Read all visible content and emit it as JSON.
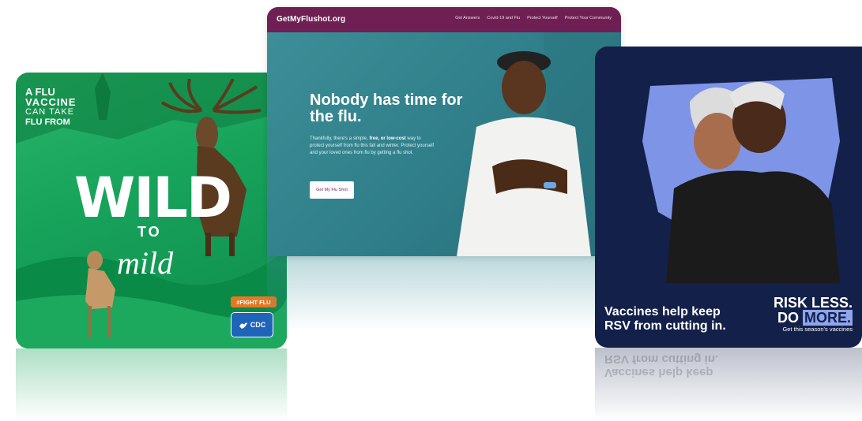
{
  "flu_card": {
    "line1": "A FLU",
    "line2": "VACCINE",
    "line3": "CAN TAKE",
    "line4": "FLU FROM",
    "headline": "WILD",
    "connector": "TO",
    "result": "mild",
    "tag": "#FIGHT FLU",
    "agency": "CDC"
  },
  "website": {
    "logo": "GetMyFlushot.org",
    "nav": [
      "Get Answers",
      "Covid-19 and Flu",
      "Protect Yourself",
      "Protect Your Community"
    ],
    "title": "Nobody has time for the flu.",
    "body_prefix": "Thankfully, there's a simple, ",
    "body_bold": "free, or low-cost",
    "body_suffix": " way to protect yourself from flu this fall and winter. Protect yourself and your loved ones from flu by getting a flu shot.",
    "cta": "Get My Flu Shot"
  },
  "rsv_card": {
    "message_line1": "Vaccines help keep",
    "message_line2": "RSV from cutting in.",
    "slogan_line1": "RISK LESS.",
    "slogan_do": "DO",
    "slogan_more": "MORE.",
    "slogan_sub": "Get this season's vaccines"
  },
  "colors": {
    "flu_green": "#17a25a",
    "site_nav": "#6f1f53",
    "site_teal": "#3e8f99",
    "rsv_navy": "#13204a",
    "rsv_accent": "#8fa5ec",
    "tag_orange": "#e87722",
    "cdc_blue": "#1e64b8"
  },
  "icons": [
    "stag-illustration",
    "fawn-illustration",
    "cdc-logo-icon",
    "chef-photo",
    "couple-photo"
  ]
}
